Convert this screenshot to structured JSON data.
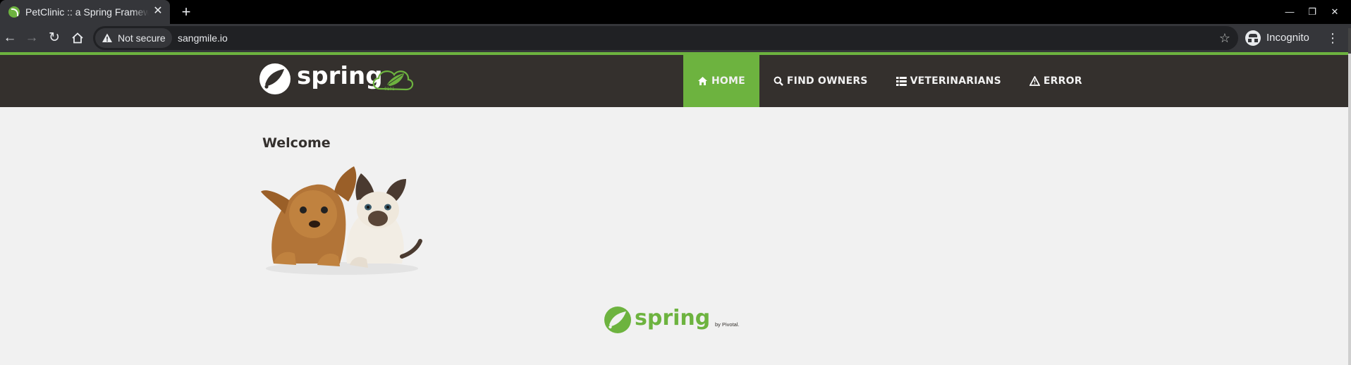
{
  "browser": {
    "tab": {
      "title": "PetClinic :: a Spring Framework demonstration"
    },
    "address": {
      "security_label": "Not secure",
      "url": "sangmile.io"
    },
    "profile": {
      "label": "Incognito"
    }
  },
  "navbar": {
    "brand": "spring",
    "items": [
      {
        "label": "HOME",
        "icon": "home-icon",
        "active": true
      },
      {
        "label": "FIND OWNERS",
        "icon": "search-icon",
        "active": false
      },
      {
        "label": "VETERINARIANS",
        "icon": "list-icon",
        "active": false
      },
      {
        "label": "ERROR",
        "icon": "warning-icon",
        "active": false
      }
    ]
  },
  "main": {
    "heading": "Welcome",
    "image": "pets-image"
  },
  "footer": {
    "logo_text": "spring",
    "logo_by": "by Pivotal."
  },
  "colors": {
    "spring_green": "#6db33f",
    "navbar_bg": "#34302d",
    "page_bg": "#f1f1f1"
  }
}
